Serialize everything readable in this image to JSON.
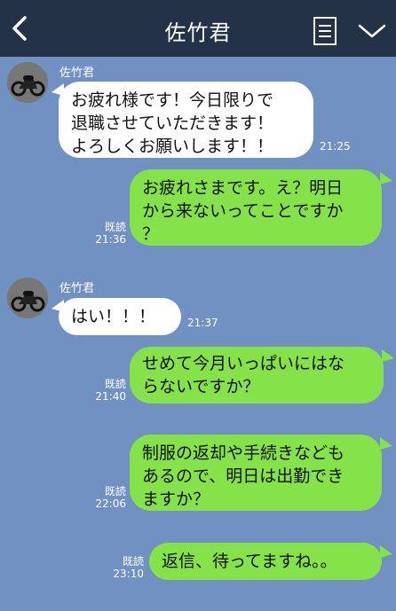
{
  "header": {
    "title": "佐竹君"
  },
  "messages": [
    {
      "sender": "佐竹君",
      "text": "お疲れ様です！今日限りで\n退職させていただきます！\nよろしくお願いします！！",
      "time": "21:25"
    },
    {
      "text": "お疲れさまです。え？明日\nから来ないってことですか\n？",
      "read": "既読",
      "time": "21:36"
    },
    {
      "sender": "佐竹君",
      "text": "はい！！！",
      "time": "21:37"
    },
    {
      "text": "せめて今月いっぱいにはな\nらないですか？",
      "read": "既読",
      "time": "21:40"
    },
    {
      "text": "制服の返却や手続きなども\nあるので、明日は出勤でき\nますか？",
      "read": "既読",
      "time": "22:06"
    },
    {
      "text": "返信、待ってますね。。",
      "read": "既読",
      "time": "23:10"
    }
  ]
}
